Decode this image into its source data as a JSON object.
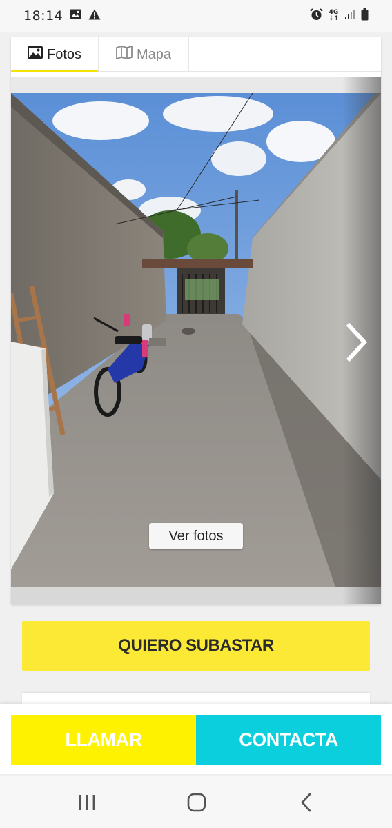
{
  "status_bar": {
    "time": "18:14",
    "left_icons": [
      "image-icon",
      "alert-icon"
    ],
    "right_icons": [
      "alarm-icon",
      "network-4g-icon",
      "signal-icon",
      "battery-icon"
    ],
    "network_label": "4G"
  },
  "tabs": [
    {
      "label": "Fotos",
      "icon": "image-icon",
      "active": true
    },
    {
      "label": "Mapa",
      "icon": "map-icon",
      "active": false
    }
  ],
  "gallery": {
    "view_photos_label": "Ver fotos",
    "next_icon": "chevron-right-icon"
  },
  "actions": {
    "auction_label": "QUIERO SUBASTAR",
    "call_label": "LLAMAR",
    "contact_label": "CONTACTA"
  },
  "colors": {
    "yellow": "#fbe936",
    "call_yellow": "#fff200",
    "cyan": "#0ccfdd"
  },
  "nav_bar": {
    "buttons": [
      "recent-apps-icon",
      "home-icon",
      "back-icon"
    ]
  }
}
